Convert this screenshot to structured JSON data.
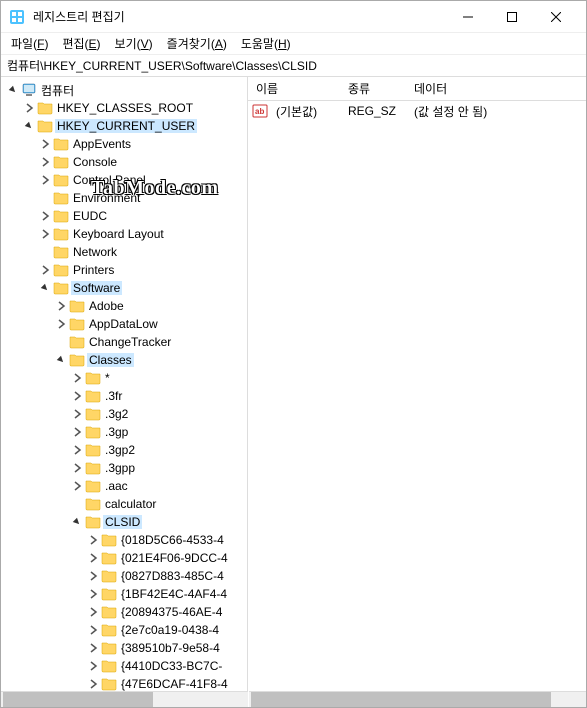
{
  "window": {
    "title": "레지스트리 편집기"
  },
  "menubar": {
    "file": "파일",
    "file_u": "F",
    "edit": "편집",
    "edit_u": "E",
    "view": "보기",
    "view_u": "V",
    "favorites": "즐겨찾기",
    "favorites_u": "A",
    "help": "도움말",
    "help_u": "H"
  },
  "addressbar": {
    "path": "컴퓨터\\HKEY_CURRENT_USER\\Software\\Classes\\CLSID"
  },
  "tree": {
    "root": "컴퓨터",
    "hkcr": "HKEY_CLASSES_ROOT",
    "hkcu": "HKEY_CURRENT_USER",
    "hkcu_children": {
      "appevents": "AppEvents",
      "console": "Console",
      "controlpanel": "Control Panel",
      "environment": "Environment",
      "eudc": "EUDC",
      "keyboardlayout": "Keyboard Layout",
      "network": "Network",
      "printers": "Printers",
      "software": "Software"
    },
    "software_children": {
      "adobe": "Adobe",
      "appdatalow": "AppDataLow",
      "changetracker": "ChangeTracker",
      "classes": "Classes"
    },
    "classes_children": {
      "star": "*",
      "ext_3fr": ".3fr",
      "ext_3g2": ".3g2",
      "ext_3gp": ".3gp",
      "ext_3gp2": ".3gp2",
      "ext_3gpp": ".3gpp",
      "ext_aac": ".aac",
      "calculator": "calculator",
      "clsid": "CLSID"
    },
    "clsid_children": [
      "{018D5C66-4533-4",
      "{021E4F06-9DCC-4",
      "{0827D883-485C-4",
      "{1BF42E4C-4AF4-4",
      "{20894375-46AE-4",
      "{2e7c0a19-0438-4",
      "{389510b7-9e58-4",
      "{4410DC33-BC7C-",
      "{47E6DCAF-41F8-4"
    ]
  },
  "list": {
    "headers": {
      "name": "이름",
      "type": "종류",
      "data": "데이터"
    },
    "rows": [
      {
        "name": "(기본값)",
        "type": "REG_SZ",
        "data": "(값 설정 안 됨)"
      }
    ]
  },
  "watermark": "TabMode.com"
}
